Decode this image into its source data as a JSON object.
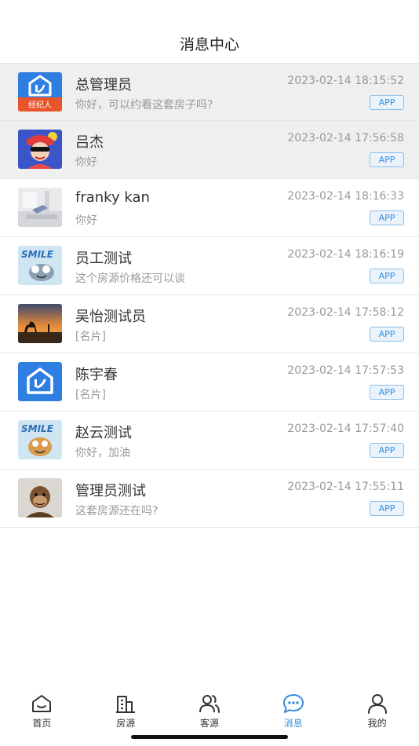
{
  "header": {
    "title": "消息中心"
  },
  "messages": [
    {
      "name": "总管理员",
      "preview": "你好，可以约看这套房子吗?",
      "time": "2023-02-14 18:15:52",
      "badge": "APP",
      "avatar": "agent-logo-icon"
    },
    {
      "name": "吕杰",
      "preview": "你好",
      "time": "2023-02-14 17:56:58",
      "badge": "APP",
      "avatar": "cartoon-portrait"
    },
    {
      "name": "franky kan",
      "preview": "你好",
      "time": "2023-02-14 18:16:33",
      "badge": "APP",
      "avatar": "interior-photo"
    },
    {
      "name": "员工测试",
      "preview": "这个房源价格还可以谈",
      "time": "2023-02-14 18:16:19",
      "badge": "APP",
      "avatar": "smile-cartoon"
    },
    {
      "name": "吴怡测试员",
      "preview": "[名片]",
      "time": "2023-02-14 17:58:12",
      "badge": "APP",
      "avatar": "desert-camel-photo"
    },
    {
      "name": "陈宇春",
      "preview": "[名片]",
      "time": "2023-02-14 17:57:53",
      "badge": "APP",
      "avatar": "house-logo-icon"
    },
    {
      "name": "赵云测试",
      "preview": "你好，加油",
      "time": "2023-02-14 17:57:40",
      "badge": "APP",
      "avatar": "smile-cartoon"
    },
    {
      "name": "管理员测试",
      "preview": "这套房源还在吗?",
      "time": "2023-02-14 17:55:11",
      "badge": "APP",
      "avatar": "ape-avatar"
    }
  ],
  "avatar_text": {
    "agent_logo": "经纪人",
    "smile": "SMILE"
  },
  "tabbar": {
    "items": [
      {
        "label": "首页",
        "icon": "home-icon"
      },
      {
        "label": "房源",
        "icon": "building-icon"
      },
      {
        "label": "客源",
        "icon": "users-icon"
      },
      {
        "label": "消息",
        "icon": "chat-icon",
        "active": true
      },
      {
        "label": "我的",
        "icon": "person-icon"
      }
    ]
  },
  "colors": {
    "accent": "#3a8ddb",
    "pinned_bg": "#efefef",
    "divider": "#e6e6e6"
  }
}
